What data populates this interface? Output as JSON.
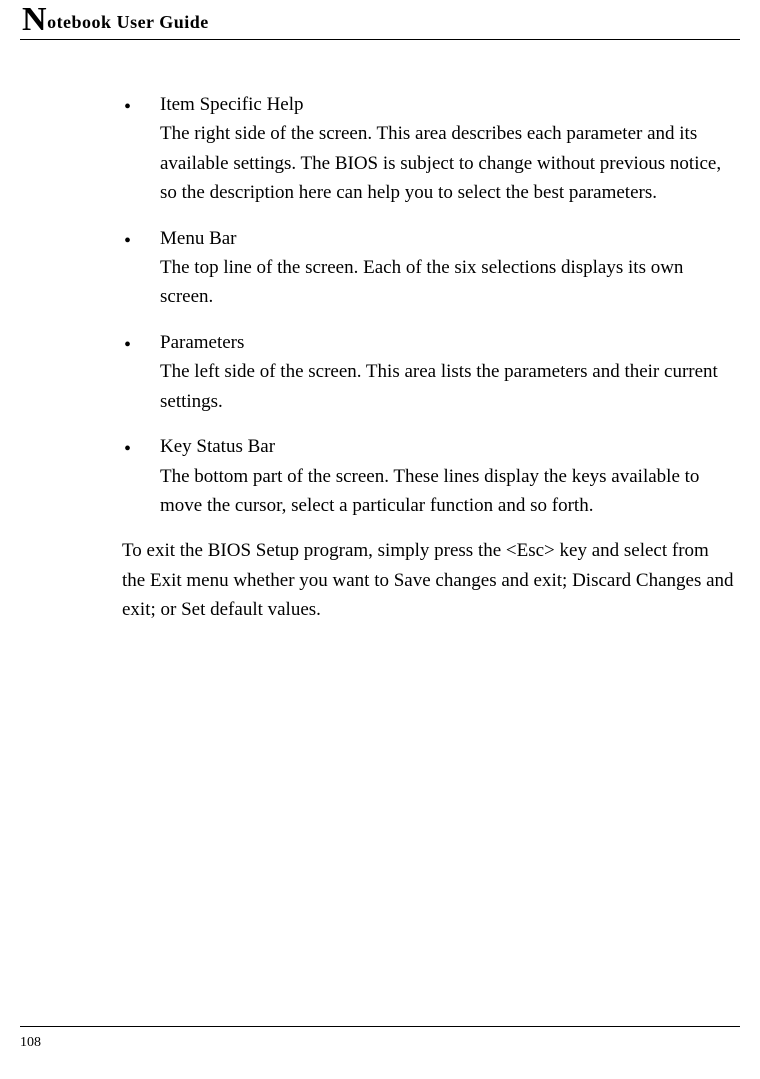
{
  "header": {
    "title_dropcap": "N",
    "title_rest": "otebook User Guide"
  },
  "bullets": [
    {
      "title": "Item Specific Help",
      "body": "The right side of the screen. This area describes each parameter and its available settings. The BIOS is subject to change without previous notice, so the description here can help you to select the best parameters."
    },
    {
      "title": "Menu Bar",
      "body": "The top line of the screen. Each of the six selections displays its own screen."
    },
    {
      "title": "Parameters",
      "body": "The left side of the screen. This area lists the parameters and their current settings."
    },
    {
      "title": "Key Status Bar",
      "body": "The bottom part of the screen. These lines display the keys available to move the cursor, select a particular function and so forth."
    }
  ],
  "closing_text": "To exit the BIOS Setup program, simply press the <Esc> key and select from the Exit menu whether you want to Save changes and exit; Discard Changes and exit; or Set default values.",
  "page_number": "108",
  "bullet_glyph": "•"
}
